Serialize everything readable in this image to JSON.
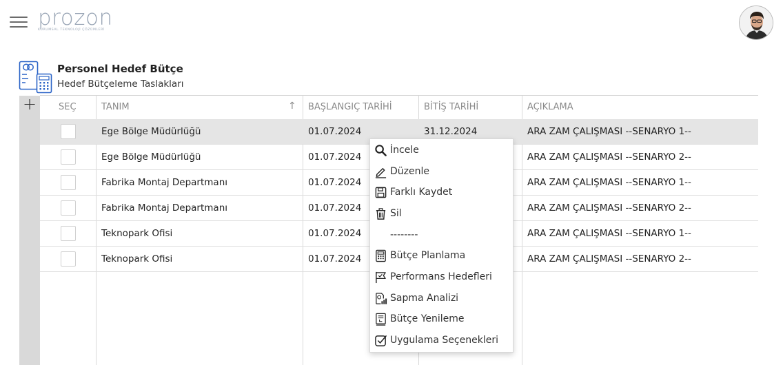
{
  "app": {
    "logo_text": "prozon",
    "logo_tagline": "KURUMSAL TEKNOLOJİ ÇÖZÜMLERİ"
  },
  "page": {
    "title": "Personel Hedef Bütçe",
    "subtitle": "Hedef Bütçeleme Taslakları"
  },
  "toolbar": {
    "add_label": "+"
  },
  "table": {
    "headers": {
      "select": "SEÇ",
      "name": "TANIM",
      "start": "BAŞLANGIÇ TARİHİ",
      "end": "BİTİŞ TARİHİ",
      "desc": "AÇIKLAMA"
    },
    "sort_indicator": "↑",
    "rows": [
      {
        "name": "Ege Bölge Müdürlüğü",
        "start": "01.07.2024",
        "end": "31.12.2024",
        "desc": "ARA ZAM ÇALIŞMASI --SENARYO 1--"
      },
      {
        "name": "Ege Bölge Müdürlüğü",
        "start": "01.07.2024",
        "end": "",
        "desc": "ARA ZAM ÇALIŞMASI --SENARYO 2--"
      },
      {
        "name": "Fabrika Montaj Departmanı",
        "start": "01.07.2024",
        "end": "",
        "desc": "ARA ZAM ÇALIŞMASI --SENARYO 1--"
      },
      {
        "name": "Fabrika Montaj Departmanı",
        "start": "01.07.2024",
        "end": "",
        "desc": "ARA ZAM ÇALIŞMASI --SENARYO 2--"
      },
      {
        "name": "Teknopark Ofisi",
        "start": "01.07.2024",
        "end": "",
        "desc": "ARA ZAM ÇALIŞMASI --SENARYO 1--"
      },
      {
        "name": "Teknopark Ofisi",
        "start": "01.07.2024",
        "end": "",
        "desc": "ARA ZAM ÇALIŞMASI --SENARYO 2--"
      }
    ]
  },
  "context_menu": {
    "inspect": "İncele",
    "edit": "Düzenle",
    "save_as": "Farklı Kaydet",
    "delete": "Sil",
    "separator": "--------",
    "budget_planning": "Bütçe Planlama",
    "performance_goals": "Performans Hedefleri",
    "variance_analysis": "Sapma Analizi",
    "budget_renewal": "Bütçe Yenileme",
    "app_options": "Uygulama Seçenekleri"
  }
}
